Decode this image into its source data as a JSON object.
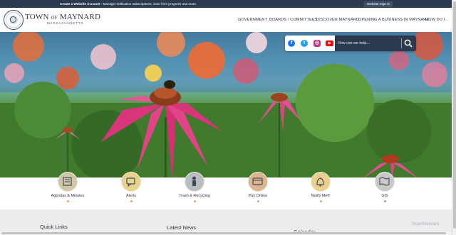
{
  "topbar": {
    "create_account": "Create a Website Account",
    "message": " - Manage notification subscriptions, save form progress and more.",
    "signin": "Website Sign In"
  },
  "logo": {
    "title_a": "TOWN ",
    "title_of": "OF",
    "title_b": " MAYNARD",
    "subtitle": "MASSACHUSETTS"
  },
  "nav": {
    "items": [
      "GOVERNMENT",
      "BOARDS / COMMITTEES",
      "DISCOVER MAYNARD",
      "OPENING A BUSINESS IN MAYNARD",
      "HOW DO I..."
    ]
  },
  "search": {
    "placeholder": "How can we help...",
    "social": [
      "facebook-icon",
      "twitter-icon",
      "instagram-icon",
      "youtube-icon"
    ]
  },
  "quick_links": [
    {
      "label": "Agendas & Minutes",
      "icon": "agenda-icon"
    },
    {
      "label": "Alerts",
      "icon": "alerts-icon"
    },
    {
      "label": "Trash & Recycling",
      "icon": "trash-icon"
    },
    {
      "label": "Pay Online",
      "icon": "pay-online-icon"
    },
    {
      "label": "Notify Me®",
      "icon": "notify-bell-icon"
    },
    {
      "label": "GIS",
      "icon": "gis-map-icon"
    }
  ],
  "lower": {
    "quick_links_heading": "Quick Links",
    "latest_news_heading": "Latest News",
    "calendar_heading": "Calendar"
  },
  "watermark": "ScanMalware",
  "colors": {
    "topbar": "#2b3a4f",
    "accent_dot": "#e8a36a",
    "icon_circle": "#d2c6a8"
  }
}
